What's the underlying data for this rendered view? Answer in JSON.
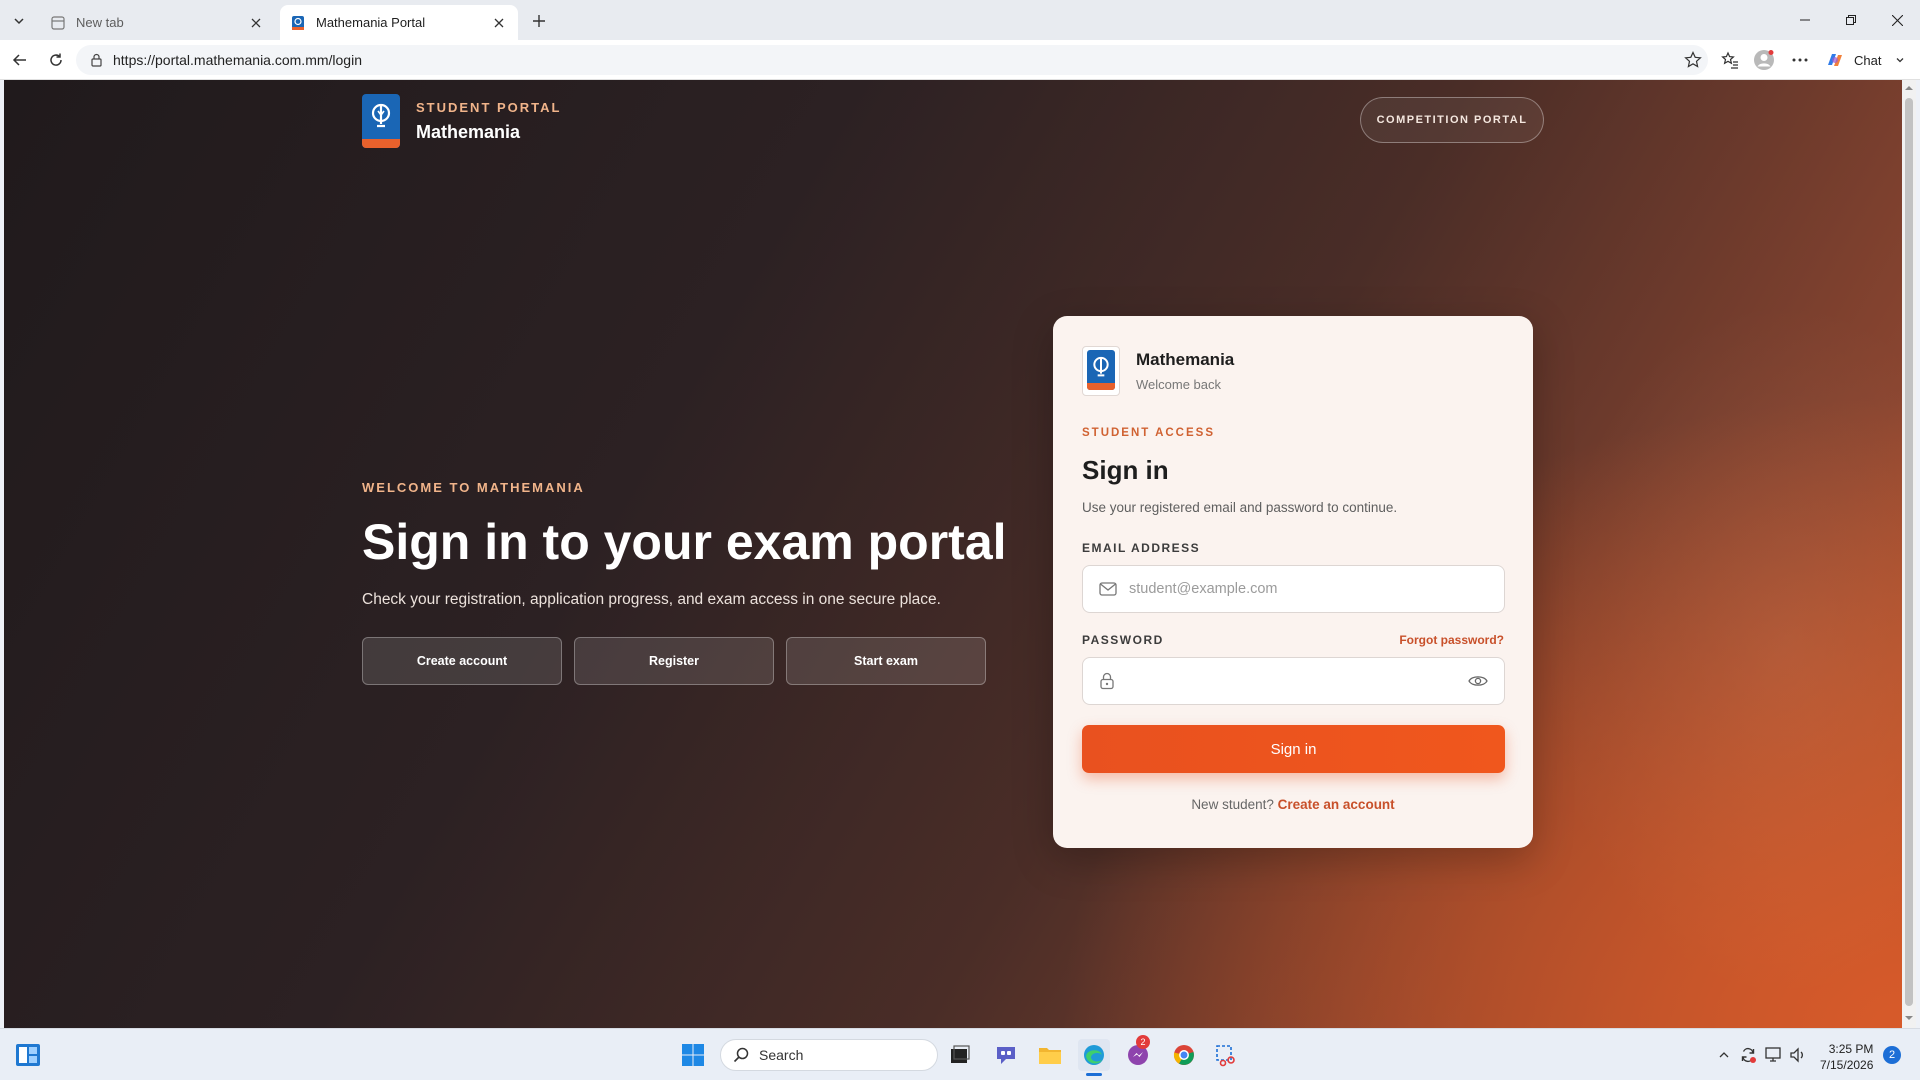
{
  "browser": {
    "tabs": [
      {
        "title": "New tab"
      },
      {
        "title": "Mathemania Portal"
      }
    ],
    "url": "https://portal.mathemania.com.mm/login",
    "chat_label": "Chat"
  },
  "page": {
    "header": {
      "kicker": "STUDENT PORTAL",
      "brand": "Mathemania",
      "competition_button": "COMPETITION PORTAL"
    },
    "hero": {
      "kicker": "WELCOME TO MATHEMANIA",
      "title": "Sign in to your exam portal",
      "subtitle": "Check your registration, application progress, and exam access in one secure place.",
      "actions": [
        "Create account",
        "Register",
        "Start exam"
      ]
    },
    "card": {
      "brand": "Mathemania",
      "brand_sub": "Welcome back",
      "kicker": "STUDENT ACCESS",
      "title": "Sign in",
      "subtitle": "Use your registered email and password to continue.",
      "email_label": "EMAIL ADDRESS",
      "email_placeholder": "student@example.com",
      "password_label": "PASSWORD",
      "forgot": "Forgot password?",
      "submit": "Sign in",
      "footer_text": "New student?",
      "footer_link": "Create an account"
    }
  },
  "taskbar": {
    "search_label": "Search",
    "time": "3:25 PM",
    "date": "7/15/2026",
    "notification_count": "2",
    "app_badge": "2"
  },
  "colors": {
    "accent": "#e9511f",
    "kicker": "#f1b48a",
    "logo_blue": "#1a66b5"
  }
}
